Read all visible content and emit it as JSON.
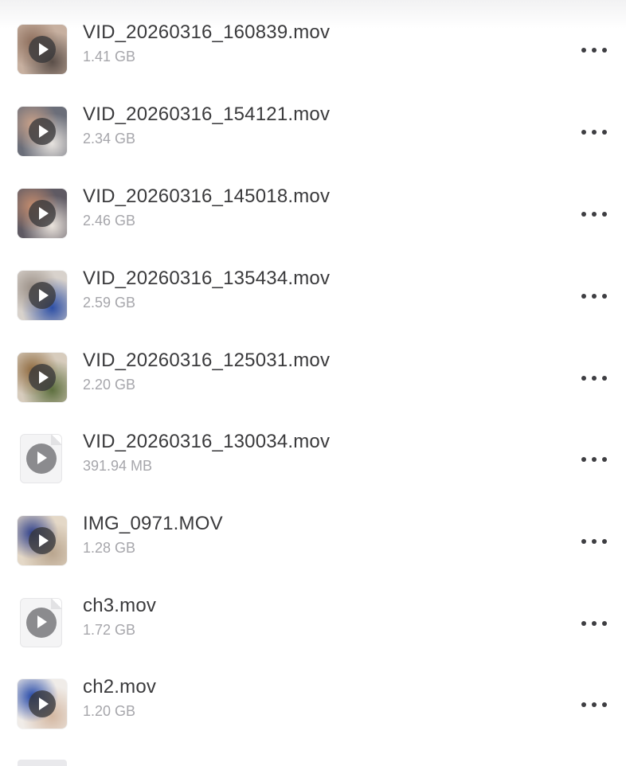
{
  "files": [
    {
      "name": "VID_20260316_160839.mov",
      "size": "1.41 GB",
      "thumb": "photo",
      "colors": [
        "#8d6e5c",
        "#5a4e48",
        "#c7b0a0"
      ]
    },
    {
      "name": "VID_20260316_154121.mov",
      "size": "2.34 GB",
      "thumb": "photo",
      "colors": [
        "#c9a189",
        "#e7e3df",
        "#6b6e79"
      ]
    },
    {
      "name": "VID_20260316_145018.mov",
      "size": "2.46 GB",
      "thumb": "photo",
      "colors": [
        "#c48c6e",
        "#eae3dc",
        "#5f5a63"
      ]
    },
    {
      "name": "VID_20260316_135434.mov",
      "size": "2.59 GB",
      "thumb": "photo",
      "colors": [
        "#9a8f86",
        "#2d4fa5",
        "#d8d2cc"
      ]
    },
    {
      "name": "VID_20260316_125031.mov",
      "size": "2.20 GB",
      "thumb": "photo",
      "colors": [
        "#8f6a3f",
        "#5d6f3e",
        "#d7ccbd"
      ]
    },
    {
      "name": "VID_20260316_130034.mov",
      "size": "391.94 MB",
      "thumb": "doc",
      "colors": []
    },
    {
      "name": "IMG_0971.MOV",
      "size": "1.28 GB",
      "thumb": "photo",
      "colors": [
        "#2e3f8a",
        "#b9a58e",
        "#e4d8c7"
      ]
    },
    {
      "name": "ch3.mov",
      "size": "1.72 GB",
      "thumb": "doc",
      "colors": []
    },
    {
      "name": "ch2.mov",
      "size": "1.20 GB",
      "thumb": "photo",
      "colors": [
        "#2448a8",
        "#d4b8a2",
        "#f0ece8"
      ]
    }
  ],
  "icons": {
    "play": "play-icon",
    "more": "more-icon"
  },
  "colors": {
    "name_text": "#3a3a3c",
    "size_text": "#a6a6ab",
    "dots": "#3e3e42"
  }
}
